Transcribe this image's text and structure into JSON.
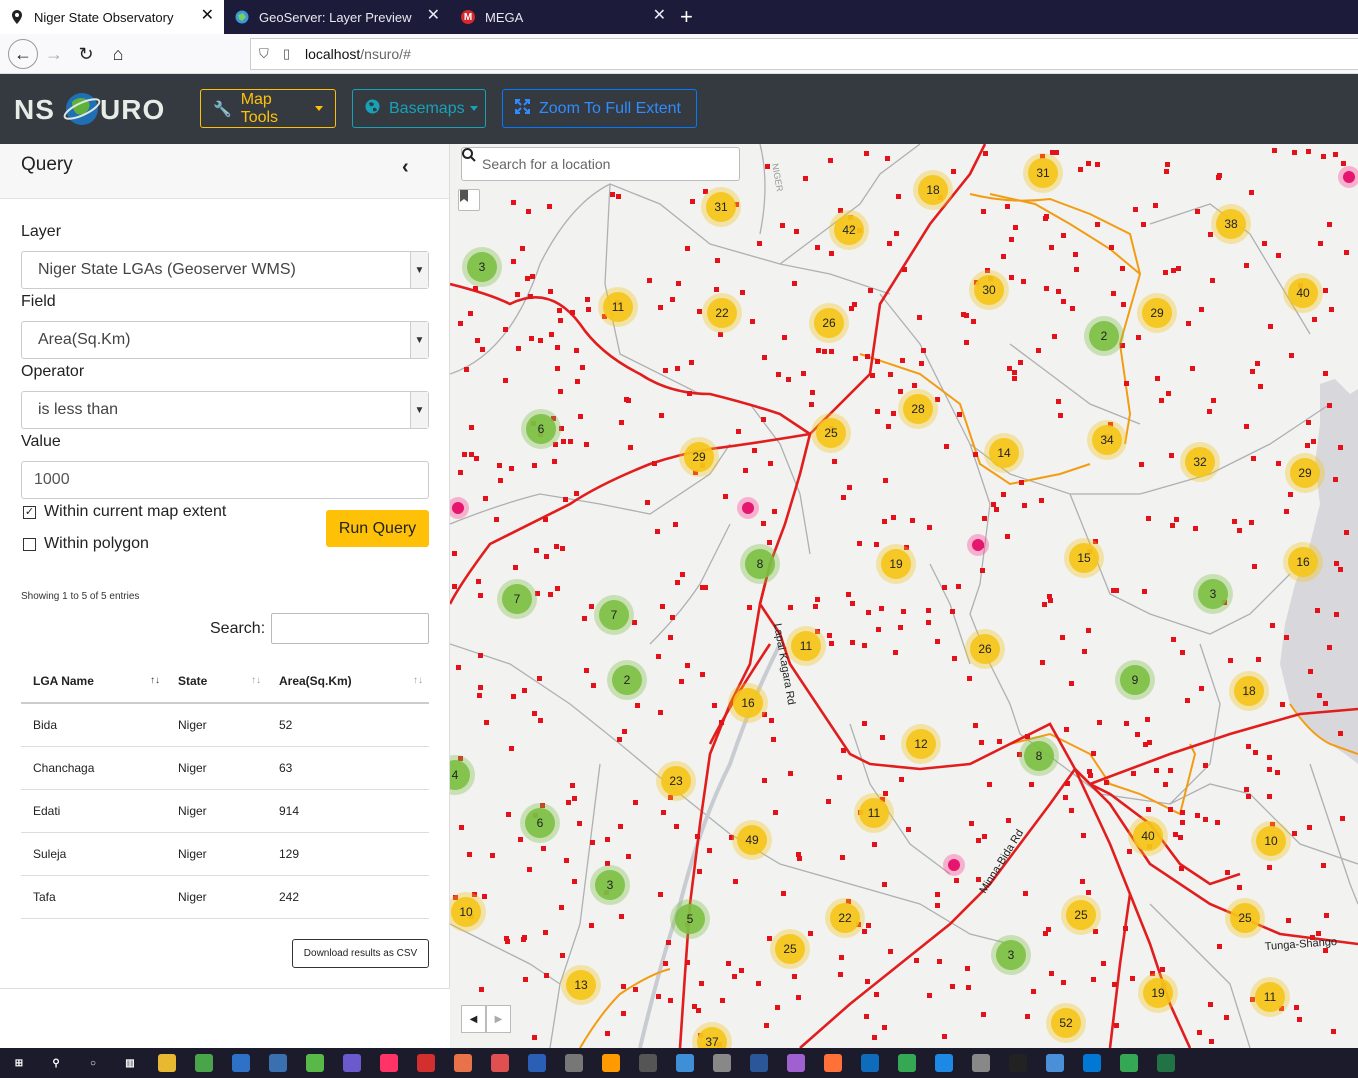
{
  "browser": {
    "tabs": [
      {
        "title": "Niger State Observatory",
        "active": true,
        "favicon": "map-pin-icon"
      },
      {
        "title": "GeoServer: Layer Preview",
        "active": false,
        "favicon": "geoserver-icon"
      },
      {
        "title": "MEGA",
        "active": false,
        "favicon": "mega-icon"
      }
    ],
    "url_host": "localhost",
    "url_path": "/nsuro/#"
  },
  "app": {
    "logo_text": "NS",
    "logo_text2": "URO",
    "buttons": {
      "map_tools": "Map Tools",
      "basemaps": "Basemaps",
      "zoom_full": "Zoom To Full Extent"
    },
    "colors": {
      "header_bg": "#343a40",
      "warning": "#ffc107",
      "info": "#17a2b8",
      "primary": "#007bff"
    }
  },
  "query": {
    "title": "Query",
    "layer_label": "Layer",
    "layer_value": "Niger State LGAs (Geoserver WMS)",
    "field_label": "Field",
    "field_value": "Area(Sq.Km)",
    "operator_label": "Operator",
    "operator_value": "is less than",
    "value_label": "Value",
    "value_value": "1000",
    "within_extent_label": "Within current map extent",
    "within_extent_checked": true,
    "within_polygon_label": "Within polygon",
    "within_polygon_checked": false,
    "run_label": "Run Query",
    "showing": "Showing 1 to 5 of 5 entries",
    "search_label": "Search:",
    "columns": [
      "LGA Name",
      "State",
      "Area(Sq.Km)"
    ],
    "rows": [
      [
        "Bida",
        "Niger",
        "52"
      ],
      [
        "Chanchaga",
        "Niger",
        "63"
      ],
      [
        "Edati",
        "Niger",
        "914"
      ],
      [
        "Suleja",
        "Niger",
        "129"
      ],
      [
        "Tafa",
        "Niger",
        "242"
      ]
    ],
    "csv_label": "Download results as CSV"
  },
  "map": {
    "search_placeholder": "Search for a location",
    "road_labels": [
      "Lapai Kagara Rd",
      "Minna-Bida Rd",
      "Tunga-Shango",
      "NIGER"
    ],
    "cluster_colors": {
      "large": "#f5c518",
      "small": "#7bc043"
    },
    "clusters": [
      {
        "n": 31,
        "c": "y"
      },
      {
        "n": 18,
        "c": "y"
      },
      {
        "n": 31,
        "c": "y"
      },
      {
        "n": 42,
        "c": "y"
      },
      {
        "n": 38,
        "c": "y"
      },
      {
        "n": 3,
        "c": "g"
      },
      {
        "n": 11,
        "c": "y"
      },
      {
        "n": 22,
        "c": "y"
      },
      {
        "n": 26,
        "c": "y"
      },
      {
        "n": 30,
        "c": "y"
      },
      {
        "n": 2,
        "c": "g"
      },
      {
        "n": 29,
        "c": "y"
      },
      {
        "n": 40,
        "c": "y"
      },
      {
        "n": 6,
        "c": "g"
      },
      {
        "n": 28,
        "c": "y"
      },
      {
        "n": 25,
        "c": "y"
      },
      {
        "n": 14,
        "c": "y"
      },
      {
        "n": 34,
        "c": "y"
      },
      {
        "n": 32,
        "c": "y"
      },
      {
        "n": 29,
        "c": "y"
      },
      {
        "n": 29,
        "c": "y"
      },
      {
        "n": 8,
        "c": "g"
      },
      {
        "n": 19,
        "c": "y"
      },
      {
        "n": 15,
        "c": "y"
      },
      {
        "n": 16,
        "c": "y"
      },
      {
        "n": 3,
        "c": "g"
      },
      {
        "n": 7,
        "c": "g"
      },
      {
        "n": 7,
        "c": "g"
      },
      {
        "n": 11,
        "c": "y"
      },
      {
        "n": 26,
        "c": "y"
      },
      {
        "n": 2,
        "c": "g"
      },
      {
        "n": 9,
        "c": "g"
      },
      {
        "n": 18,
        "c": "y"
      },
      {
        "n": 16,
        "c": "y"
      },
      {
        "n": 12,
        "c": "y"
      },
      {
        "n": 8,
        "c": "g"
      },
      {
        "n": 4,
        "c": "g"
      },
      {
        "n": 23,
        "c": "y"
      },
      {
        "n": 11,
        "c": "y"
      },
      {
        "n": 6,
        "c": "g"
      },
      {
        "n": 49,
        "c": "y"
      },
      {
        "n": 40,
        "c": "y"
      },
      {
        "n": 10,
        "c": "y"
      },
      {
        "n": 3,
        "c": "g"
      },
      {
        "n": 10,
        "c": "y"
      },
      {
        "n": 5,
        "c": "g"
      },
      {
        "n": 22,
        "c": "y"
      },
      {
        "n": 25,
        "c": "y"
      },
      {
        "n": 25,
        "c": "y"
      },
      {
        "n": 25,
        "c": "y"
      },
      {
        "n": 3,
        "c": "g"
      },
      {
        "n": 13,
        "c": "y"
      },
      {
        "n": 19,
        "c": "y"
      },
      {
        "n": 11,
        "c": "y"
      },
      {
        "n": 52,
        "c": "y"
      },
      {
        "n": 37,
        "c": "y"
      }
    ]
  },
  "taskbar": {
    "icons": [
      "windows-icon",
      "search-icon",
      "cortana-icon",
      "task-view-icon",
      "file-explorer-icon",
      "geo-icon",
      "vscode-icon",
      "pgadmin-icon",
      "qgis-icon",
      "app-icon",
      "indesign-icon",
      "acrobat-icon",
      "app-icon-2",
      "app-icon-3",
      "visio-icon",
      "app-icon-4",
      "illustrator-icon",
      "vector-icon",
      "search-app-icon",
      "app-icon-5",
      "word-icon",
      "app-icon-6",
      "firefox-icon",
      "outlook-icon",
      "chrome-icon",
      "mail-icon",
      "network-icon",
      "cmd-icon",
      "notepad-icon",
      "app-icon-7",
      "chrome-2-icon",
      "excel-icon"
    ]
  }
}
